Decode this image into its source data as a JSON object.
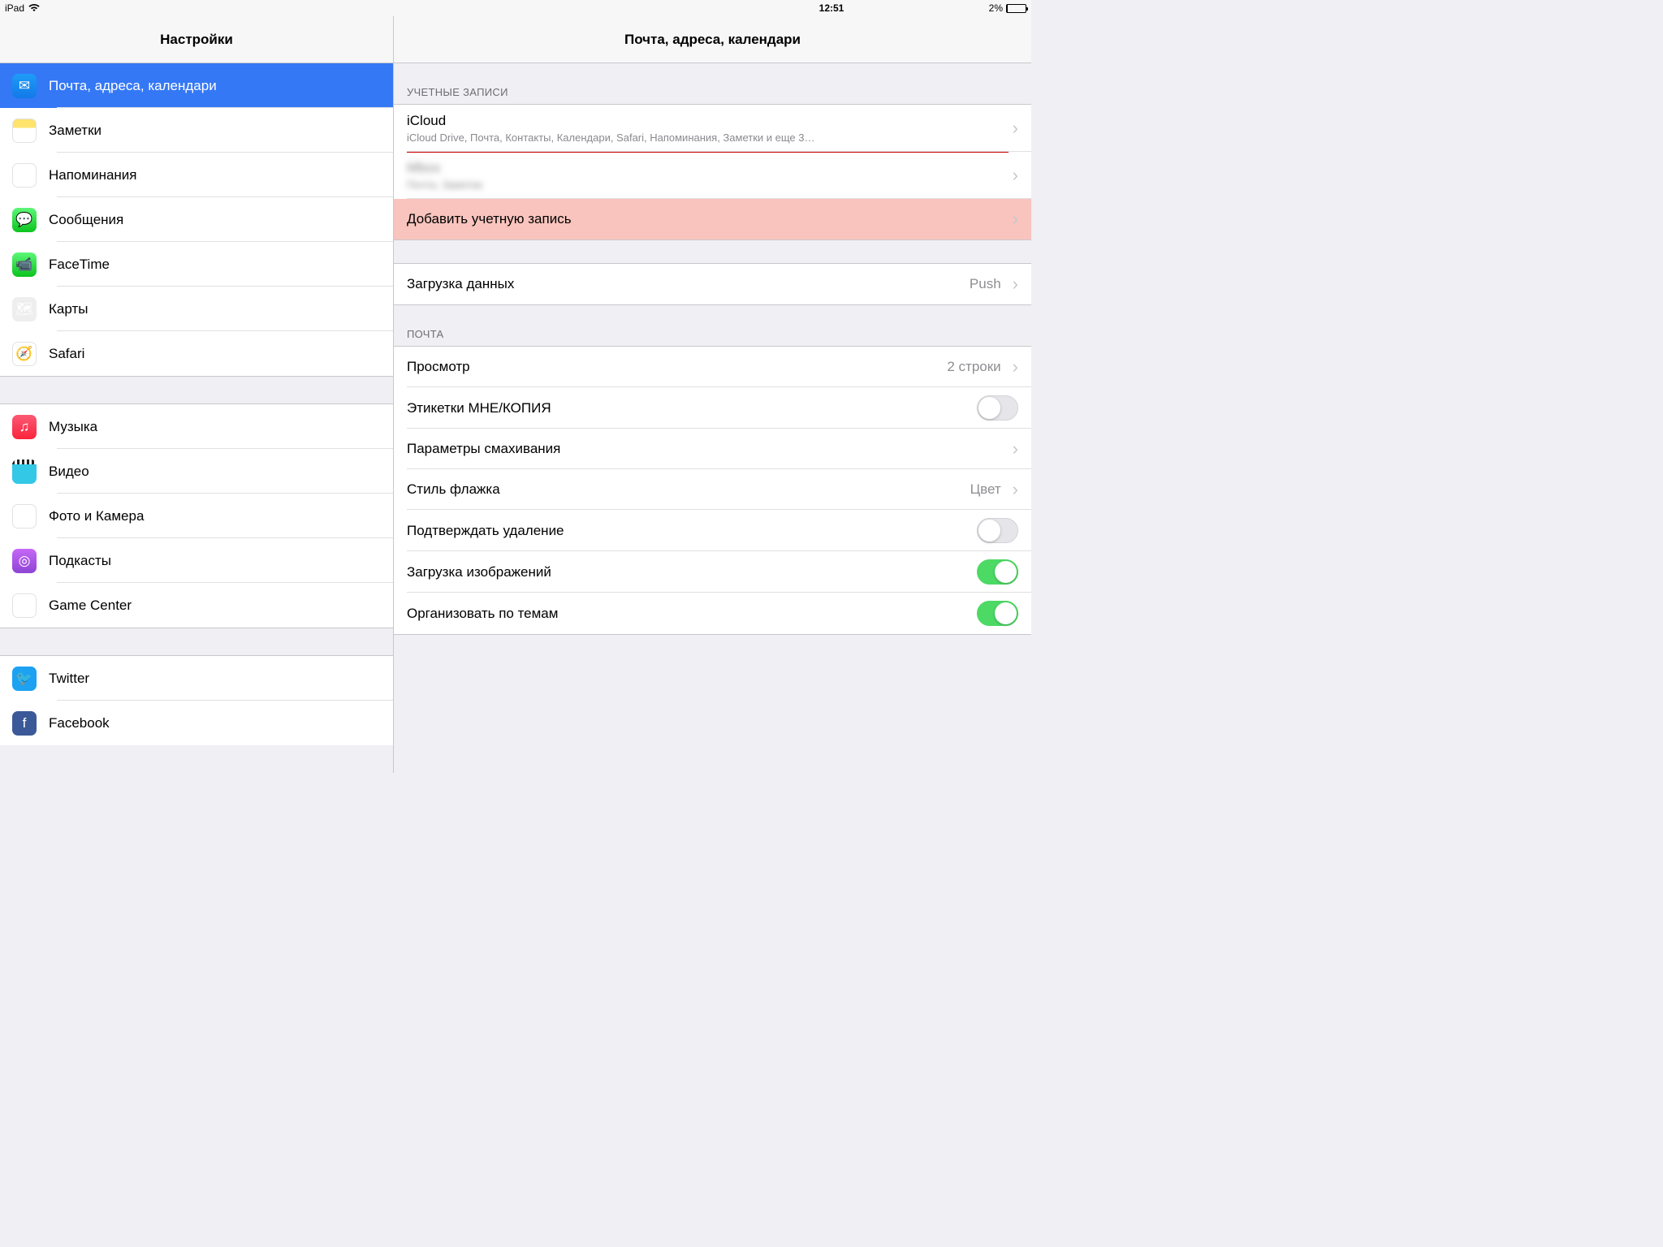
{
  "status": {
    "device": "iPad",
    "time": "12:51",
    "battery": "2%"
  },
  "sidebar": {
    "title": "Настройки",
    "groups": [
      [
        {
          "id": "mail",
          "label": "Почта, адреса, календари",
          "icon": "ic-mail",
          "glyph": "✉",
          "selected": true
        },
        {
          "id": "notes",
          "label": "Заметки",
          "icon": "ic-notes",
          "glyph": ""
        },
        {
          "id": "reminders",
          "label": "Напоминания",
          "icon": "ic-reminders",
          "glyph": "⋮"
        },
        {
          "id": "messages",
          "label": "Сообщения",
          "icon": "ic-msg",
          "glyph": "💬"
        },
        {
          "id": "facetime",
          "label": "FaceTime",
          "icon": "ic-ft",
          "glyph": "📹"
        },
        {
          "id": "maps",
          "label": "Карты",
          "icon": "ic-maps",
          "glyph": "🗺"
        },
        {
          "id": "safari",
          "label": "Safari",
          "icon": "ic-safari",
          "glyph": "🧭"
        }
      ],
      [
        {
          "id": "music",
          "label": "Музыка",
          "icon": "ic-music",
          "glyph": "♫"
        },
        {
          "id": "video",
          "label": "Видео",
          "icon": "ic-video",
          "glyph": ""
        },
        {
          "id": "photos",
          "label": "Фото и Камера",
          "icon": "ic-photos",
          "glyph": "❀"
        },
        {
          "id": "podcasts",
          "label": "Подкасты",
          "icon": "ic-podcasts",
          "glyph": "◎"
        },
        {
          "id": "gamecenter",
          "label": "Game Center",
          "icon": "ic-gc",
          "glyph": "●"
        }
      ],
      [
        {
          "id": "twitter",
          "label": "Twitter",
          "icon": "ic-tw",
          "glyph": "🐦"
        },
        {
          "id": "facebook",
          "label": "Facebook",
          "icon": "ic-fb",
          "glyph": "f"
        }
      ]
    ]
  },
  "detail": {
    "title": "Почта, адреса, календари",
    "accounts_header": "УЧЕТНЫЕ ЗАПИСИ",
    "accounts": [
      {
        "id": "icloud",
        "title": "iCloud",
        "sub": "iCloud Drive, Почта, Контакты, Календари, Safari, Напоминания, Заметки и еще 3…",
        "underline": true
      },
      {
        "id": "blurred",
        "title": "Mbox",
        "sub": "Почта, Заметки",
        "blurred": true
      }
    ],
    "add_account": "Добавить учетную запись",
    "fetch": {
      "label": "Загрузка данных",
      "value": "Push"
    },
    "mail_header": "ПОЧТА",
    "mail": [
      {
        "id": "preview",
        "label": "Просмотр",
        "value": "2 строки",
        "type": "link"
      },
      {
        "id": "to-cc",
        "label": "Этикетки МНЕ/КОПИЯ",
        "type": "toggle",
        "on": false
      },
      {
        "id": "swipe",
        "label": "Параметры смахивания",
        "type": "link"
      },
      {
        "id": "flag",
        "label": "Стиль флажка",
        "value": "Цвет",
        "type": "link"
      },
      {
        "id": "ask-delete",
        "label": "Подтверждать удаление",
        "type": "toggle",
        "on": false
      },
      {
        "id": "load-images",
        "label": "Загрузка изображений",
        "type": "toggle",
        "on": true
      },
      {
        "id": "thread",
        "label": "Организовать по темам",
        "type": "toggle",
        "on": true
      }
    ]
  }
}
